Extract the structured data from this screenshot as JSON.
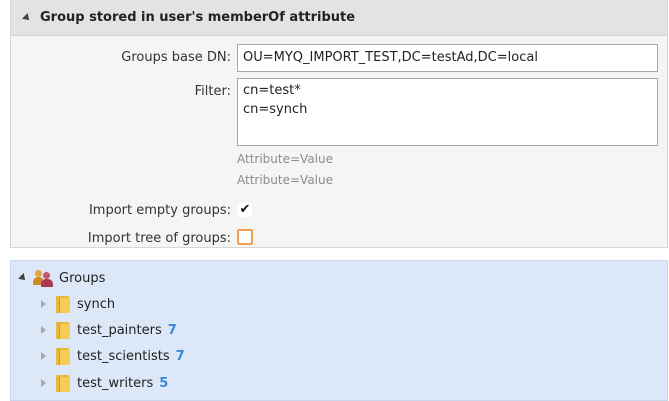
{
  "section": {
    "title": "Group stored in user's memberOf attribute"
  },
  "form": {
    "groups_base_dn_label": "Groups base DN:",
    "groups_base_dn_value": "OU=MYQ_IMPORT_TEST,DC=testAd,DC=local",
    "filter_label": "Filter:",
    "filter_value": "cn=test*\ncn=synch",
    "filter_hint_1": "Attribute=Value",
    "filter_hint_2": "Attribute=Value",
    "import_empty_groups_label": "Import empty groups:",
    "import_empty_groups_checked": true,
    "import_tree_label": "Import tree of groups:",
    "import_tree_checked": false
  },
  "tree": {
    "root_label": "Groups",
    "items": [
      {
        "label": "synch",
        "count": ""
      },
      {
        "label": "test_painters",
        "count": "7"
      },
      {
        "label": "test_scientists",
        "count": "7"
      },
      {
        "label": "test_writers",
        "count": "5"
      }
    ]
  },
  "colors": {
    "count_blue": "#3a87d6",
    "tree_bg": "#dce7f7",
    "checkbox_focus": "#f0a050"
  }
}
